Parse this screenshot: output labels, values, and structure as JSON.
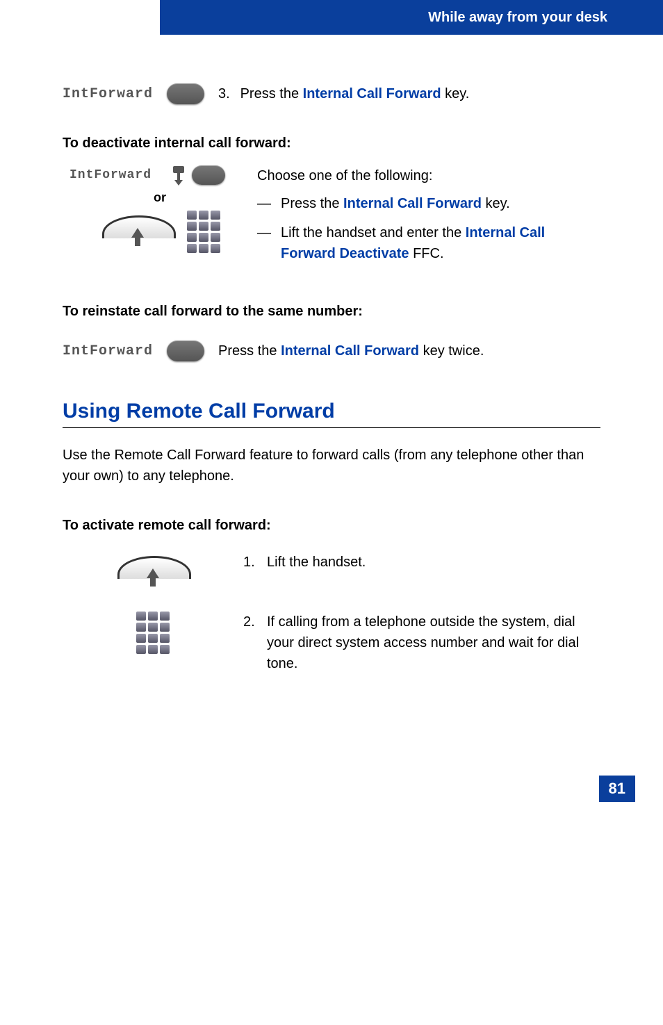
{
  "header": {
    "title": "While away from your desk"
  },
  "step3": {
    "keyLabel": "IntForward",
    "num": "3.",
    "textPrefix": "Press the ",
    "link": "Internal Call Forward",
    "textSuffix": " key."
  },
  "deactivate": {
    "heading": "To deactivate internal call forward:",
    "keyLabel": "IntForward",
    "or": "or",
    "chooseText": "Choose one of the following:",
    "opt1Prefix": "Press the ",
    "opt1Link": "Internal Call Forward",
    "opt1Suffix": " key.",
    "opt2Prefix": "Lift the handset and enter the ",
    "opt2Link": "Internal Call Forward Deactivate",
    "opt2Suffix": " FFC."
  },
  "reinstate": {
    "heading": "To reinstate call forward to the same number:",
    "keyLabel": "IntForward",
    "textPrefix": "Press the ",
    "link": "Internal Call Forward",
    "textSuffix": " key twice."
  },
  "remote": {
    "sectionTitle": "Using Remote Call Forward",
    "intro": "Use the Remote Call Forward feature to forward calls (from any telephone other than your own) to any telephone.",
    "activateHeading": "To activate remote call forward:",
    "step1": {
      "num": "1.",
      "text": "Lift the handset."
    },
    "step2": {
      "num": "2.",
      "text": "If calling from a telephone outside the system, dial your direct system access number and wait for dial tone."
    }
  },
  "pageNumber": "81"
}
